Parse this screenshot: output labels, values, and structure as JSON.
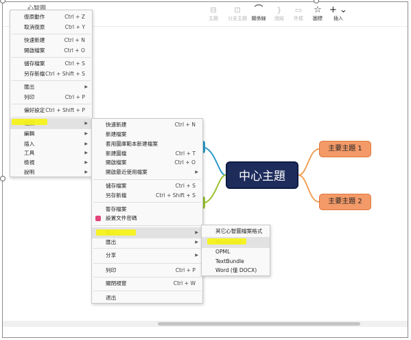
{
  "window": {
    "title": "心智圖"
  },
  "toolbar": {
    "items": [
      {
        "label": "主題",
        "icon": "topic-icon",
        "glyph": "⊟",
        "enabled": false
      },
      {
        "label": "分支主題",
        "icon": "subtopic-icon",
        "glyph": "⊡",
        "enabled": false
      },
      {
        "label": "關係線",
        "icon": "relationship-icon",
        "glyph": "⌒",
        "enabled": true
      },
      {
        "label": "總結",
        "icon": "summary-icon",
        "glyph": "}",
        "enabled": false
      },
      {
        "label": "外框",
        "icon": "boundary-icon",
        "glyph": "▭",
        "enabled": false
      },
      {
        "label": "圖標",
        "icon": "star-icon",
        "glyph": "☆",
        "enabled": true
      },
      {
        "label": "插入",
        "icon": "plus-icon",
        "glyph": "+ ⌄",
        "enabled": true
      }
    ]
  },
  "main_menu": {
    "items": [
      {
        "label": "復原動作",
        "shortcut": "Ctrl + Z"
      },
      {
        "label": "取消復原",
        "shortcut": "Ctrl + Y"
      },
      {
        "label": "快速新建",
        "shortcut": "Ctrl + N"
      },
      {
        "label": "開啟檔案",
        "shortcut": "Ctrl + O"
      },
      {
        "label": "儲存檔案",
        "shortcut": "Ctrl + S"
      },
      {
        "label": "另存新檔",
        "shortcut": "Ctrl + Shift + S"
      },
      {
        "label": "匯出",
        "submenu": true
      },
      {
        "label": "列印",
        "shortcut": "Ctrl + P"
      },
      {
        "label": "偏好設定",
        "shortcut": "Ctrl + Shift + P"
      },
      {
        "label": "檔案",
        "submenu": true,
        "highlighted": true
      },
      {
        "label": "編輯",
        "submenu": true
      },
      {
        "label": "插入",
        "submenu": true
      },
      {
        "label": "工具",
        "submenu": true
      },
      {
        "label": "檢視",
        "submenu": true
      },
      {
        "label": "說明",
        "submenu": true
      }
    ]
  },
  "file_menu": {
    "items": [
      {
        "label": "快速新建",
        "shortcut": "Ctrl + N"
      },
      {
        "label": "新建檔案"
      },
      {
        "label": "套用圖庫範本新建檔案"
      },
      {
        "label": "新建圖檔",
        "shortcut": "Ctrl + T"
      },
      {
        "label": "開啟檔案",
        "shortcut": "Ctrl + O"
      },
      {
        "label": "開啟最近使用檔案",
        "submenu": true
      },
      {
        "label": "儲存檔案",
        "shortcut": "Ctrl + S"
      },
      {
        "label": "另存新檔",
        "shortcut": "Ctrl + Shift + S"
      },
      {
        "label": "暫存檔案"
      },
      {
        "label": "設置文件密碼",
        "icon": "lock-icon"
      },
      {
        "label": "匯入",
        "submenu": true,
        "highlighted": true
      },
      {
        "label": "匯出",
        "submenu": true
      },
      {
        "label": "分享",
        "submenu": true
      },
      {
        "label": "列印",
        "shortcut": "Ctrl + P"
      },
      {
        "label": "關閉視窗",
        "shortcut": "Ctrl + W"
      },
      {
        "label": "退出"
      }
    ]
  },
  "import_menu": {
    "items": [
      {
        "label": "其它心智圖檔案格式"
      },
      {
        "label": "Markdown",
        "highlighted": true
      },
      {
        "label": "OPML"
      },
      {
        "label": "TextBundle"
      },
      {
        "label": "Word (僅 DOCX)"
      }
    ]
  },
  "mindmap": {
    "central": "中心主題",
    "topics": [
      "主要主題 1",
      "主要主題 2"
    ],
    "colors": {
      "central": "#1e2c5c",
      "topic": "#f39a68",
      "line_orange": "#f0a057",
      "line_blue": "#2a9bc9",
      "line_green": "#9cc22d"
    }
  },
  "highlight_color": "#f6f21a"
}
